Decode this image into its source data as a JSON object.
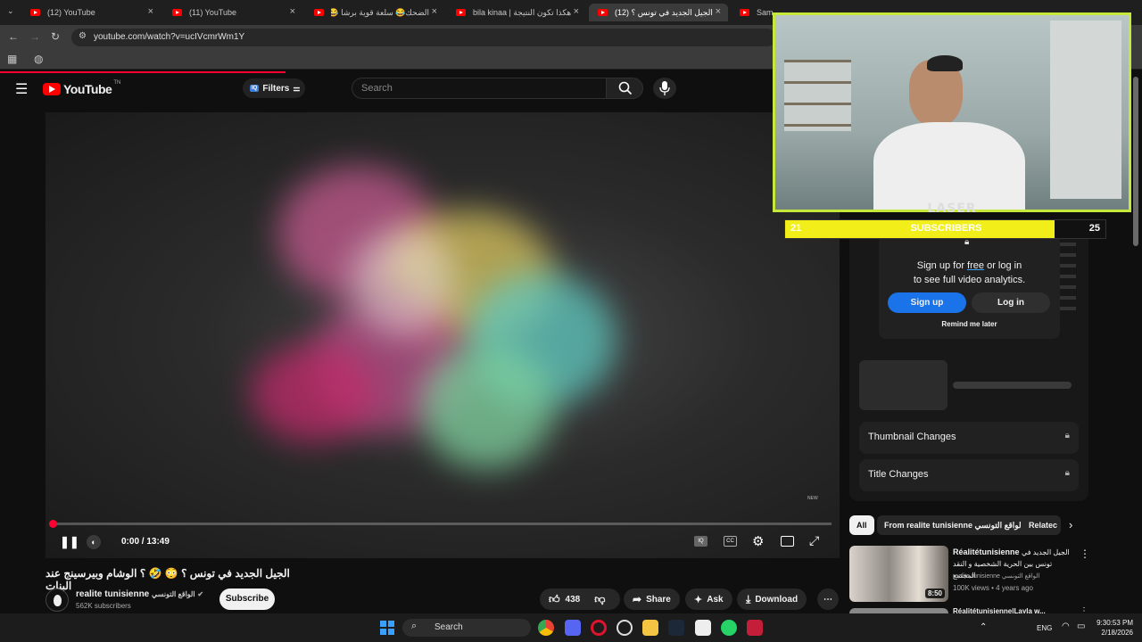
{
  "browser": {
    "tabs": [
      {
        "title": "(12) YouTube",
        "active": false
      },
      {
        "title": "(11) YouTube",
        "active": false
      },
      {
        "title": "الضحك😂 سلعة قوية برشا 😂😂",
        "active": false
      },
      {
        "title": "bila kinaa | هكذا تكون النتيجة!!...",
        "active": false
      },
      {
        "title": "(12) الجيل الجديد في تونس ؟!",
        "active": true
      },
      {
        "title": "Sam...",
        "active": false
      }
    ],
    "url": "youtube.com/watch?v=ucIVcmrWm1Y"
  },
  "youtube": {
    "logo_text": "YouTube",
    "logo_sup": "TN",
    "filters_label": "Filters",
    "filters_badge": "IQ",
    "search_placeholder": "Search"
  },
  "player": {
    "time": "0:00 / 13:49",
    "watermark": "NEW"
  },
  "video": {
    "title": "الجيل الجديد في تونس ؟ 😳 🤣 ؟ الوشام وبيرسينج عند البنات",
    "channel_name": "realite tunisienne",
    "channel_arabic": "الواقع التونسي",
    "subscribers": "562K subscribers",
    "subscribe_label": "Subscribe",
    "likes": "438",
    "share_label": "Share",
    "ask_label": "Ask",
    "download_label": "Download"
  },
  "analytics_popup": {
    "line1_prefix": "Sign up for ",
    "line1_free": "free",
    "line1_suffix": " or log in",
    "line2": "to see full video analytics.",
    "signup_label": "Sign up",
    "login_label": "Log in",
    "remind_label": "Remind me later"
  },
  "locked_rows": [
    {
      "label": "Thumbnail Changes"
    },
    {
      "label": "Title Changes"
    }
  ],
  "chips": {
    "all": "All",
    "from": "From realite tunisienne الواقع التونسي",
    "related": "Relatec"
  },
  "recommended": {
    "title_latin": "Réalitétunisienne",
    "title_arabic": "الجيل الجديد في تونس بين الحرية الشخصية و النقد المجتمع",
    "channel": "realite tunisienne الواقع التونسي",
    "meta": "100K views • 4 years ago",
    "duration": "8:50",
    "next_title": "Réalitétunisienne|Layla w..."
  },
  "stream_overlay": {
    "name": "LASER",
    "sub_current": "21",
    "sub_label": "SUBSCRIBERS",
    "sub_goal": "25",
    "sub_progress": 0.84
  },
  "taskbar": {
    "search_label": "Search",
    "lang": "ENG",
    "time": "9:30:53 PM",
    "date": "2/18/2026"
  }
}
